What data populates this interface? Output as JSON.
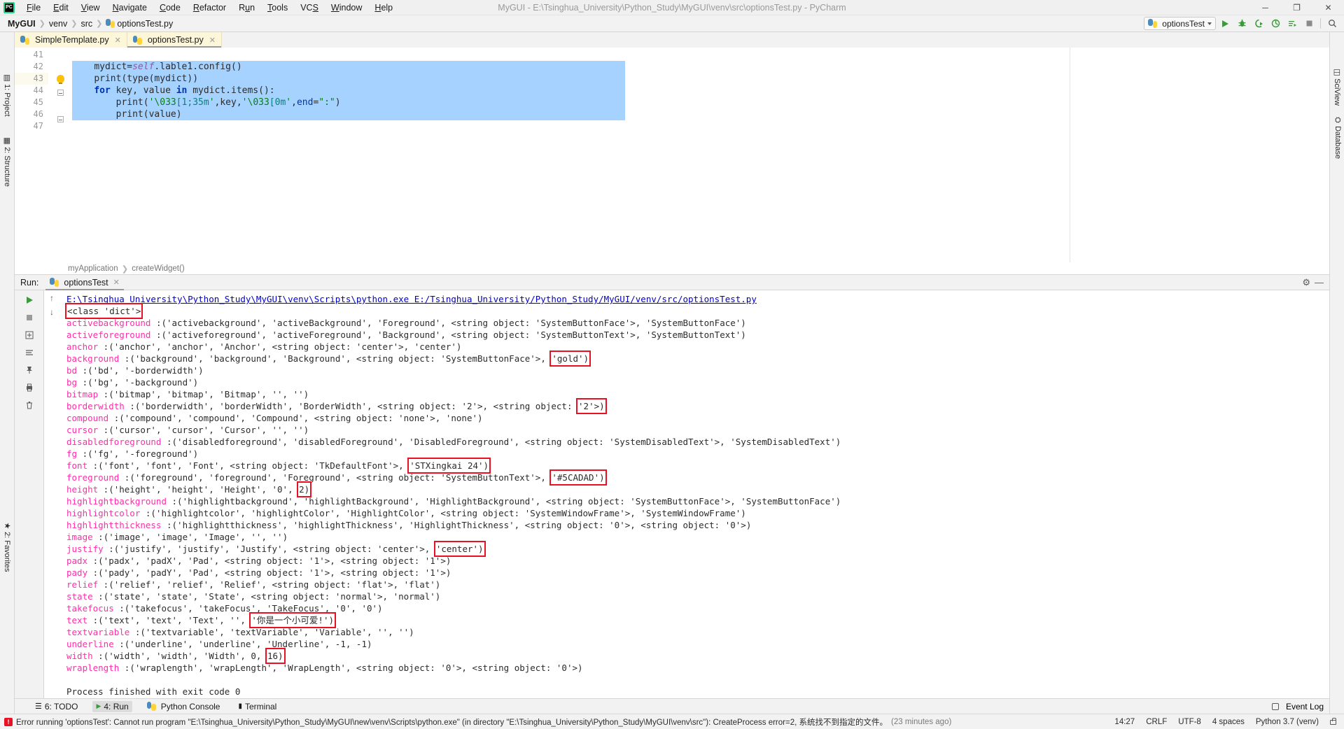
{
  "window": {
    "title": "MyGUI - E:\\Tsinghua_University\\Python_Study\\MyGUI\\venv\\src\\optionsTest.py - PyCharm",
    "minimize": "─",
    "maximize": "❐",
    "close": "✕"
  },
  "menu": [
    {
      "label": "File"
    },
    {
      "label": "Edit"
    },
    {
      "label": "View"
    },
    {
      "label": "Navigate"
    },
    {
      "label": "Code"
    },
    {
      "label": "Refactor"
    },
    {
      "label": "Run"
    },
    {
      "label": "Tools"
    },
    {
      "label": "VCS"
    },
    {
      "label": "Window"
    },
    {
      "label": "Help"
    }
  ],
  "breadcrumbs": [
    {
      "label": "MyGUI",
      "bold": true
    },
    {
      "label": "venv",
      "bold": false
    },
    {
      "label": "src",
      "bold": false
    },
    {
      "label": "optionsTest.py",
      "bold": false,
      "icon": "python-file-icon"
    }
  ],
  "toolbar": {
    "run_config": "optionsTest",
    "buttons": [
      {
        "name": "run-button",
        "glyph": "▶",
        "color": "#3c9a3c"
      },
      {
        "name": "debug-button",
        "glyph": "☣",
        "color": "#3c9a3c"
      },
      {
        "name": "run-coverage-button",
        "glyph": "◑",
        "color": "#3c9a3c"
      },
      {
        "name": "profile-button",
        "glyph": "◴",
        "color": "#3c9a3c"
      },
      {
        "name": "run-with-console-button",
        "glyph": "≡",
        "color": "#3c9a3c"
      },
      {
        "name": "stop-button",
        "glyph": "■",
        "color": "#8a8a8a"
      },
      {
        "name": "search-everywhere-button",
        "glyph": "⚲",
        "color": "#5a5a5a"
      }
    ]
  },
  "editor_tabs": [
    {
      "label": "SimpleTemplate.py",
      "active": false
    },
    {
      "label": "optionsTest.py",
      "active": true
    }
  ],
  "editor": {
    "lines": [
      {
        "num": "41",
        "tokens": [],
        "selected": false,
        "current": false,
        "gutter_icon": null
      },
      {
        "num": "42",
        "selected": true,
        "current": false,
        "gutter_icon": null,
        "tokens": [
          {
            "t": "        ",
            "c": "id"
          },
          {
            "t": "mydict",
            "c": "id"
          },
          {
            "t": "=",
            "c": "punc"
          },
          {
            "t": "self",
            "c": "self"
          },
          {
            "t": ".lable1.config()",
            "c": "id"
          }
        ]
      },
      {
        "num": "43",
        "selected": true,
        "current": true,
        "gutter_icon": "lightbulb-icon",
        "tokens": [
          {
            "t": "        ",
            "c": "id"
          },
          {
            "t": "print",
            "c": "id"
          },
          {
            "t": "(",
            "c": "punc"
          },
          {
            "t": "type",
            "c": "id"
          },
          {
            "t": "(mydict))",
            "c": "punc"
          }
        ]
      },
      {
        "num": "44",
        "selected": true,
        "current": false,
        "gutter_icon": "fold-icon",
        "tokens": [
          {
            "t": "        ",
            "c": "id"
          },
          {
            "t": "for",
            "c": "k"
          },
          {
            "t": " key, value ",
            "c": "id"
          },
          {
            "t": "in",
            "c": "k"
          },
          {
            "t": " mydict.items():",
            "c": "id"
          }
        ]
      },
      {
        "num": "45",
        "selected": true,
        "current": false,
        "gutter_icon": null,
        "tokens": [
          {
            "t": "            ",
            "c": "id"
          },
          {
            "t": "print",
            "c": "id"
          },
          {
            "t": "(",
            "c": "punc"
          },
          {
            "t": "'\\033",
            "c": "s"
          },
          {
            "t": "[1;35m",
            "c": "se"
          },
          {
            "t": "'",
            "c": "s"
          },
          {
            "t": ",key,",
            "c": "punc"
          },
          {
            "t": "'\\033",
            "c": "s"
          },
          {
            "t": "[0m",
            "c": "se"
          },
          {
            "t": "'",
            "c": "s"
          },
          {
            "t": ",",
            "c": "punc"
          },
          {
            "t": "end",
            "c": "kw"
          },
          {
            "t": "=",
            "c": "punc"
          },
          {
            "t": "\":\"",
            "c": "s"
          },
          {
            "t": ")",
            "c": "punc"
          }
        ]
      },
      {
        "num": "46",
        "selected": true,
        "current": false,
        "gutter_icon": "fold-icon",
        "tokens": [
          {
            "t": "            ",
            "c": "id"
          },
          {
            "t": "print",
            "c": "id"
          },
          {
            "t": "(value)",
            "c": "punc"
          }
        ]
      },
      {
        "num": "47",
        "tokens": [],
        "selected": false,
        "current": false,
        "gutter_icon": null
      }
    ],
    "crumbs": [
      "myApplication",
      "createWidget()"
    ]
  },
  "run_window": {
    "label": "Run:",
    "tab": "optionsTest",
    "side_buttons": [
      {
        "name": "rerun-button",
        "glyph": "▶"
      },
      {
        "name": "stop-button",
        "glyph": "■"
      },
      {
        "name": "expand-button",
        "glyph": "⊞"
      },
      {
        "name": "collapse-button",
        "glyph": "≡"
      },
      {
        "name": "pin-button",
        "glyph": "✐"
      },
      {
        "name": "print-button",
        "glyph": "⎙"
      },
      {
        "name": "delete-button",
        "glyph": "🗑"
      }
    ],
    "scroll_buttons": [
      {
        "name": "scroll-up-button",
        "glyph": "↑"
      },
      {
        "name": "scroll-down-button",
        "glyph": "↓"
      }
    ],
    "header_buttons": [
      {
        "name": "settings-gear-icon",
        "glyph": "⚙"
      },
      {
        "name": "hide-window-button",
        "glyph": "─"
      }
    ],
    "console": [
      {
        "type": "cmd",
        "text": "E:\\Tsinghua_University\\Python_Study\\MyGUI\\venv\\Scripts\\python.exe E:/Tsinghua_University/Python_Study/MyGUI/venv/src/optionsTest.py"
      },
      {
        "type": "plain",
        "text": "<class 'dict'>",
        "highlight": "full"
      },
      {
        "type": "opt",
        "key": "activebackground",
        "rest": " :('activebackground', 'activeBackground', 'Foreground', <string object: 'SystemButtonFace'>, 'SystemButtonFace')"
      },
      {
        "type": "opt",
        "key": "activeforeground",
        "rest": " :('activeforeground', 'activeForeground', 'Background', <string object: 'SystemButtonText'>, 'SystemButtonText')"
      },
      {
        "type": "opt",
        "key": "anchor",
        "rest": " :('anchor', 'anchor', 'Anchor', <string object: 'center'>, 'center')"
      },
      {
        "type": "opt",
        "key": "background",
        "rest": " :('background', 'background', 'Background', <string object: 'SystemButtonFace'>, ",
        "hl": "'gold')",
        "tail": ""
      },
      {
        "type": "opt",
        "key": "bd",
        "rest": " :('bd', '-borderwidth')"
      },
      {
        "type": "opt",
        "key": "bg",
        "rest": " :('bg', '-background')"
      },
      {
        "type": "opt",
        "key": "bitmap",
        "rest": " :('bitmap', 'bitmap', 'Bitmap', '', '')"
      },
      {
        "type": "opt",
        "key": "borderwidth",
        "rest": " :('borderwidth', 'borderWidth', 'BorderWidth', <string object: '2'>, <string object: ",
        "hl": "'2'>)",
        "tail": ""
      },
      {
        "type": "opt",
        "key": "compound",
        "rest": " :('compound', 'compound', 'Compound', <string object: 'none'>, 'none')"
      },
      {
        "type": "opt",
        "key": "cursor",
        "rest": " :('cursor', 'cursor', 'Cursor', '', '')"
      },
      {
        "type": "opt",
        "key": "disabledforeground",
        "rest": " :('disabledforeground', 'disabledForeground', 'DisabledForeground', <string object: 'SystemDisabledText'>, 'SystemDisabledText')"
      },
      {
        "type": "opt",
        "key": "fg",
        "rest": " :('fg', '-foreground')"
      },
      {
        "type": "opt",
        "key": "font",
        "rest": " :('font', 'font', 'Font', <string object: 'TkDefaultFont'>, ",
        "hl": "'STXingkai 24')",
        "tail": ""
      },
      {
        "type": "opt",
        "key": "foreground",
        "rest": " :('foreground', 'foreground', 'Foreground', <string object: 'SystemButtonText'>, ",
        "hl": "'#5CADAD')",
        "tail": ""
      },
      {
        "type": "opt",
        "key": "height",
        "rest": " :('height', 'height', 'Height', '0', ",
        "hl": "2)",
        "tail": ""
      },
      {
        "type": "opt",
        "key": "highlightbackground",
        "rest": " :('highlightbackground', 'highlightBackground', 'HighlightBackground', <string object: 'SystemButtonFace'>, 'SystemButtonFace')"
      },
      {
        "type": "opt",
        "key": "highlightcolor",
        "rest": " :('highlightcolor', 'highlightColor', 'HighlightColor', <string object: 'SystemWindowFrame'>, 'SystemWindowFrame')"
      },
      {
        "type": "opt",
        "key": "highlightthickness",
        "rest": " :('highlightthickness', 'highlightThickness', 'HighlightThickness', <string object: '0'>, <string object: '0'>)"
      },
      {
        "type": "opt",
        "key": "image",
        "rest": " :('image', 'image', 'Image', '', '')"
      },
      {
        "type": "opt",
        "key": "justify",
        "rest": " :('justify', 'justify', 'Justify', <string object: 'center'>, ",
        "hl": "'center')",
        "tail": ""
      },
      {
        "type": "opt",
        "key": "padx",
        "rest": " :('padx', 'padX', 'Pad', <string object: '1'>, <string object: '1'>)"
      },
      {
        "type": "opt",
        "key": "pady",
        "rest": " :('pady', 'padY', 'Pad', <string object: '1'>, <string object: '1'>)"
      },
      {
        "type": "opt",
        "key": "relief",
        "rest": " :('relief', 'relief', 'Relief', <string object: 'flat'>, 'flat')"
      },
      {
        "type": "opt",
        "key": "state",
        "rest": " :('state', 'state', 'State', <string object: 'normal'>, 'normal')"
      },
      {
        "type": "opt",
        "key": "takefocus",
        "rest": " :('takefocus', 'takeFocus', 'TakeFocus', '0', '0')"
      },
      {
        "type": "opt",
        "key": "text",
        "rest": " :('text', 'text', 'Text', '', ",
        "hl": "'你是一个小可爱!')",
        "tail": ""
      },
      {
        "type": "opt",
        "key": "textvariable",
        "rest": " :('textvariable', 'textVariable', 'Variable', '', '')"
      },
      {
        "type": "opt",
        "key": "underline",
        "rest": " :('underline', 'underline', 'Underline', -1, -1)"
      },
      {
        "type": "opt",
        "key": "width",
        "rest": " :('width', 'width', 'Width', 0, ",
        "hl": "16)",
        "tail": ""
      },
      {
        "type": "opt",
        "key": "wraplength",
        "rest": " :('wraplength', 'wrapLength', 'WrapLength', <string object: '0'>, <string object: '0'>)"
      },
      {
        "type": "blank",
        "text": ""
      },
      {
        "type": "plain",
        "text": "Process finished with exit code 0"
      }
    ]
  },
  "left_sidebar": [
    {
      "label": "1: Project",
      "icon": "project-icon"
    },
    {
      "label": "2: Structure",
      "icon": "structure-icon"
    },
    {
      "label": "2: Favorites",
      "icon": "favorites-icon"
    }
  ],
  "right_sidebar": [
    {
      "label": "SciView",
      "icon": "sciview-icon"
    },
    {
      "label": "Database",
      "icon": "database-icon"
    }
  ],
  "bottom_strip": {
    "items": [
      {
        "label": "6: TODO",
        "icon": "todo-icon",
        "active": false
      },
      {
        "label": "4: Run",
        "icon": "run-icon",
        "active": true
      },
      {
        "label": "Python Console",
        "icon": "python-console-icon",
        "active": false
      },
      {
        "label": "Terminal",
        "icon": "terminal-icon",
        "active": false
      }
    ],
    "event_log": "Event Log"
  },
  "statusbar": {
    "error": "Error running 'optionsTest': Cannot run program \"E:\\Tsinghua_University\\Python_Study\\MyGUI\\new\\venv\\Scripts\\python.exe\" (in directory \"E:\\Tsinghua_University\\Python_Study\\MyGUI\\venv\\src\"): CreateProcess error=2, 系统找不到指定的文件。",
    "age": "(23 minutes ago)",
    "time": "14:27",
    "line_sep": "CRLF",
    "encoding": "UTF-8",
    "indent": "4 spaces",
    "interpreter": "Python 3.7 (venv)"
  },
  "colors": {
    "accent_red": "#e81123",
    "tab_yellow": "#fdf6d8",
    "selection_blue": "#a6d2ff",
    "key_pink": "#ff2ea8",
    "link_blue": "#0000cc"
  }
}
